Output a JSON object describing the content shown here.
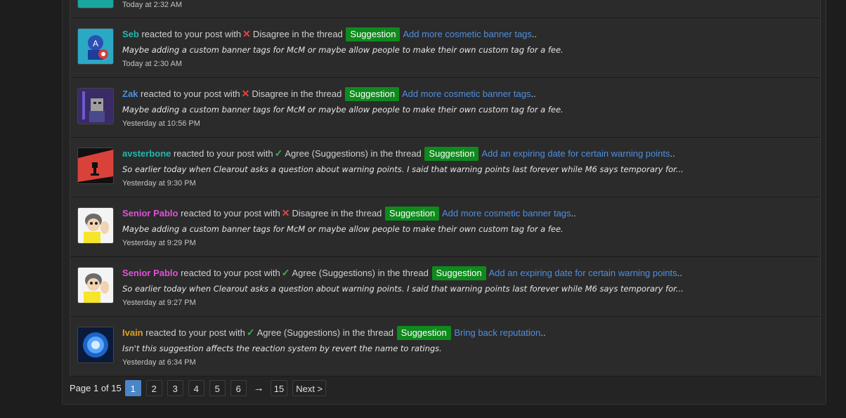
{
  "colors": {
    "user_teal": "#22b8b0",
    "user_blue": "#4f8fe0",
    "user_pink": "#e052d6",
    "user_orange": "#e0a020",
    "tag_green": "#0f8a1d",
    "link_blue": "#4f8fe0"
  },
  "first_row": {
    "time": "Today at 2:32 AM"
  },
  "alerts": [
    {
      "user": "Seb",
      "user_color": "#22b8b0",
      "avatar": "captain-america-avatar",
      "pre": "reacted to your post with",
      "reaction_icon": "cross-icon",
      "reaction": "Disagree",
      "mid": "in the thread",
      "tag": "Suggestion",
      "thread": "Add more cosmetic banner tags",
      "tail": "..",
      "snippet": "Maybe adding a custom banner tags for McM or maybe allow people to make their own custom tag for a fee.",
      "time": "Today at 2:30 AM"
    },
    {
      "user": "Zak",
      "user_color": "#4f8fe0",
      "avatar": "purple-knight-avatar",
      "pre": "reacted to your post with",
      "reaction_icon": "cross-icon",
      "reaction": "Disagree",
      "mid": "in the thread",
      "tag": "Suggestion",
      "thread": "Add more cosmetic banner tags",
      "tail": "..",
      "snippet": "Maybe adding a custom banner tags for McM or maybe allow people to make their own custom tag for a fee.",
      "time": "Yesterday at 10:56 PM"
    },
    {
      "user": "avsterbone",
      "user_color": "#22b8b0",
      "avatar": "red-ninja-avatar",
      "pre": "reacted to your post with",
      "reaction_icon": "check-icon",
      "reaction": "Agree (Suggestions)",
      "mid": "in the thread",
      "tag": "Suggestion",
      "thread": "Add an expiring date for certain warning points",
      "tail": "..",
      "snippet": "So earlier today when Clearout asks a question about warning points. I said that warning points last forever while M6 says temporary for...",
      "time": "Yesterday at 9:30 PM"
    },
    {
      "user": "Senior Pablo",
      "user_color": "#e052d6",
      "avatar": "cartoon-guy-avatar",
      "pre": "reacted to your post with",
      "reaction_icon": "cross-icon",
      "reaction": "Disagree",
      "mid": "in the thread",
      "tag": "Suggestion",
      "thread": "Add more cosmetic banner tags",
      "tail": "..",
      "snippet": "Maybe adding a custom banner tags for McM or maybe allow people to make their own custom tag for a fee.",
      "time": "Yesterday at 9:29 PM"
    },
    {
      "user": "Senior Pablo",
      "user_color": "#e052d6",
      "avatar": "cartoon-guy-avatar",
      "pre": "reacted to your post with",
      "reaction_icon": "check-icon",
      "reaction": "Agree (Suggestions)",
      "mid": "in the thread",
      "tag": "Suggestion",
      "thread": "Add an expiring date for certain warning points",
      "tail": "..",
      "snippet": "So earlier today when Clearout asks a question about warning points. I said that warning points last forever while M6 says temporary for...",
      "time": "Yesterday at 9:27 PM"
    },
    {
      "user": "Ivain",
      "user_color": "#e0a020",
      "avatar": "blue-orb-avatar",
      "pre": "reacted to your post with",
      "reaction_icon": "check-icon",
      "reaction": "Agree (Suggestions)",
      "mid": "in the thread",
      "tag": "Suggestion",
      "thread": "Bring back reputation",
      "tail": "..",
      "snippet": "Isn't this suggestion affects the reaction system by revert the name to ratings.",
      "time": "Yesterday at 6:34 PM"
    }
  ],
  "pagination": {
    "label": "Page 1 of 15",
    "pages": [
      "1",
      "2",
      "3",
      "4",
      "5",
      "6"
    ],
    "arrow": "→",
    "last": "15",
    "next": "Next >"
  }
}
